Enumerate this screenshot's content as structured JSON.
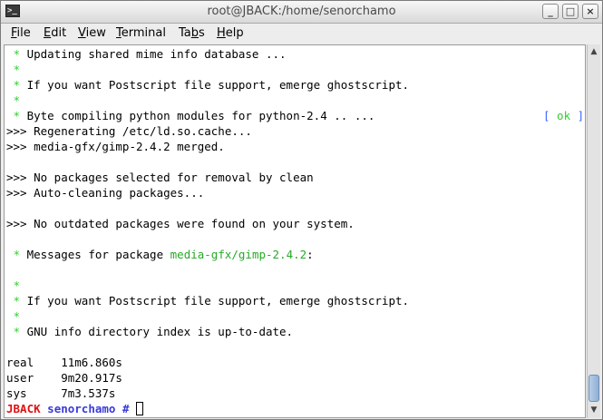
{
  "window": {
    "title": "root@JBACK:/home/senorchamo",
    "minimize_glyph": "_",
    "maximize_glyph": "□",
    "close_glyph": "×"
  },
  "menu": [
    {
      "underline": "F",
      "rest": "ile"
    },
    {
      "underline": "E",
      "rest": "dit"
    },
    {
      "underline": "V",
      "rest": "iew"
    },
    {
      "underline": "T",
      "rest": "erminal"
    },
    {
      "pre": "Ta",
      "underline": "b",
      "rest": "s"
    },
    {
      "underline": "H",
      "rest": "elp"
    }
  ],
  "terminal": {
    "l1_star": " *",
    "l1": " Updating shared mime info database ...",
    "l2_star": " *",
    "l3_star": " *",
    "l3": " If you want Postscript file support, emerge ghostscript.",
    "l4_star": " *",
    "l5_star": " *",
    "l5": " Byte compiling python modules for python-2.4 .. ...",
    "ok_open": "[",
    "ok_text": " ok ",
    "ok_close": "]",
    "l6": ">>> Regenerating /etc/ld.so.cache...",
    "l7": ">>> media-gfx/gimp-2.4.2 merged.",
    "l9": ">>> No packages selected for removal by clean",
    "l10": ">>> Auto-cleaning packages...",
    "l12": ">>> No outdated packages were found on your system.",
    "l14_star": " *",
    "l14_a": " Messages for package ",
    "l14_pkg": "media-gfx/gimp-2.4.2",
    "l14_b": ":",
    "l16_star": " *",
    "l17_star": " *",
    "l17": " If you want Postscript file support, emerge ghostscript.",
    "l18_star": " *",
    "l19_star": " *",
    "l19": " GNU info directory index is up-to-date.",
    "l21": "real    11m6.860s",
    "l22": "user    9m20.917s",
    "l23": "sys     7m3.537s",
    "prompt_host": "JBACK",
    "prompt_dir": " senorchamo #",
    "prompt_space": " "
  },
  "icons": {
    "app": "terminal-icon",
    "scroll_up": "▲",
    "scroll_down": "▼"
  }
}
